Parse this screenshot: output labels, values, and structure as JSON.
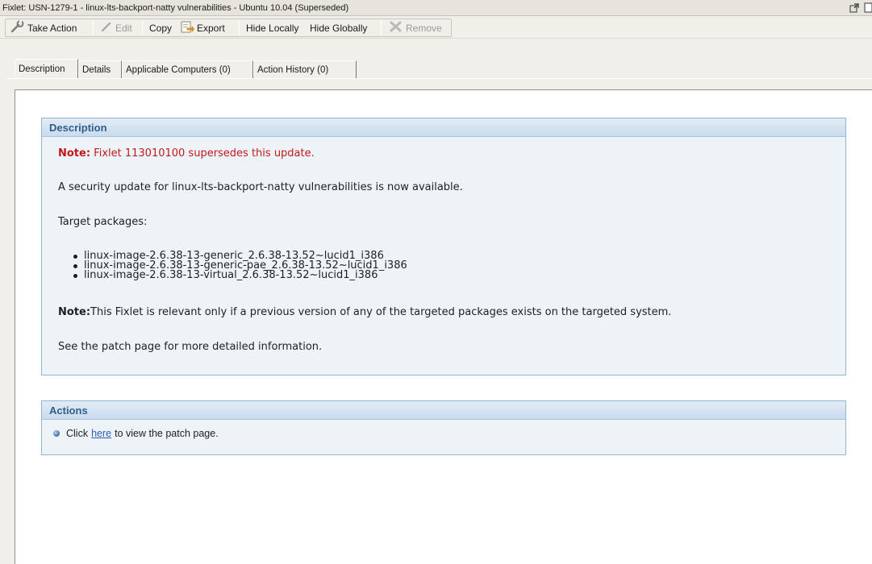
{
  "window": {
    "title": "Fixlet: USN-1279-1 - linux-lts-backport-natty vulnerabilities - Ubuntu 10.04 (Superseded)"
  },
  "toolbar": {
    "take_action": "Take Action",
    "edit": "Edit",
    "copy": "Copy",
    "export": "Export",
    "hide_locally": "Hide Locally",
    "hide_globally": "Hide Globally",
    "remove": "Remove"
  },
  "tabs": [
    {
      "label": "Description",
      "active": true
    },
    {
      "label": "Details",
      "active": false
    },
    {
      "label": "Applicable Computers (0)",
      "active": false
    },
    {
      "label": "Action History (0)",
      "active": false
    }
  ],
  "description": {
    "header": "Description",
    "note_label": "Note:",
    "note_text": " Fixlet 113010100 supersedes this update.",
    "summary": "A security update for linux-lts-backport-natty vulnerabilities is now available.",
    "target_label": "Target packages:",
    "packages": [
      "linux-image-2.6.38-13-generic_2.6.38-13.52~lucid1_i386",
      "linux-image-2.6.38-13-generic-pae_2.6.38-13.52~lucid1_i386",
      "linux-image-2.6.38-13-virtual_2.6.38-13.52~lucid1_i386"
    ],
    "note2_label": "Note:",
    "note2_text": "This Fixlet is relevant only if a previous version of any of the targeted packages exists on the targeted system.",
    "see_patch": "See the patch page for more detailed information."
  },
  "actions": {
    "header": "Actions",
    "prefix": "Click",
    "link_text": "here",
    "suffix": "to view the patch page."
  },
  "icons": {
    "take_action": "wrench-icon",
    "edit": "pencil-icon",
    "export": "export-icon",
    "remove": "remove-x-icon",
    "title_right": [
      "undock-icon",
      "window-icon"
    ]
  },
  "colors": {
    "note_red": "#c0191c",
    "panel_header_text": "#2f5e8c",
    "panel_bg": "#eef3f8",
    "panel_border": "#8fb4d4",
    "link": "#2a5fb0"
  }
}
